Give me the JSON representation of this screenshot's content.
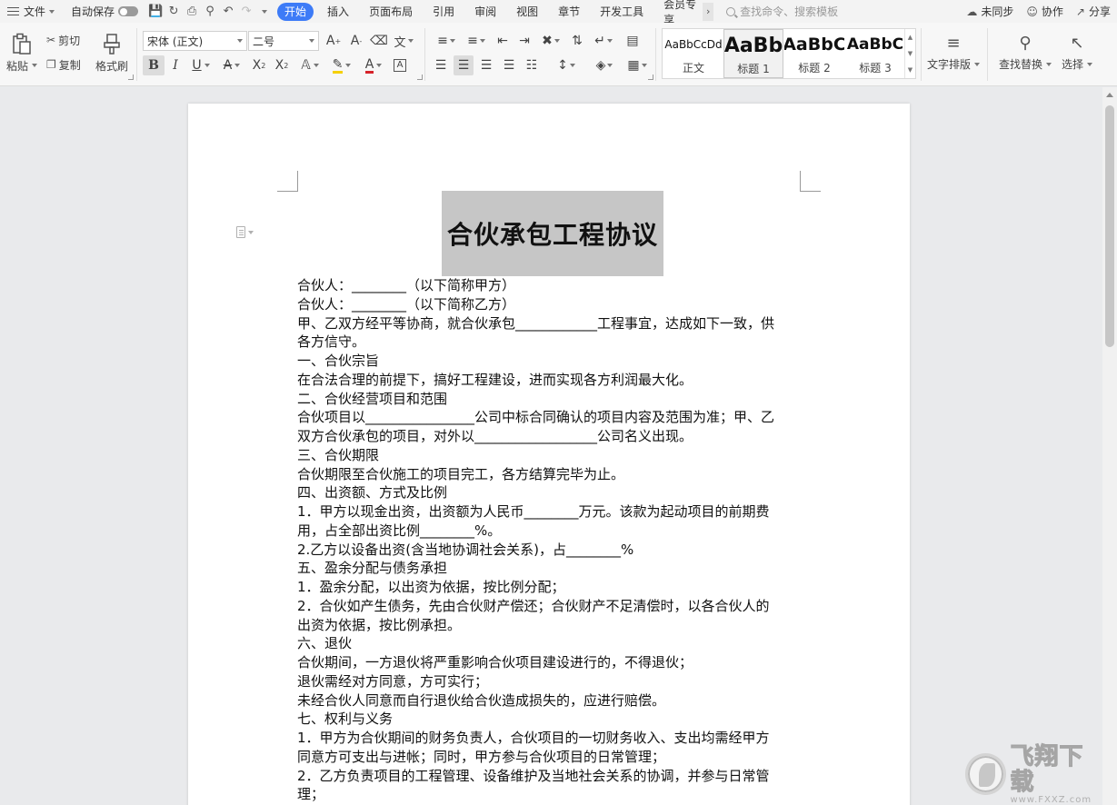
{
  "menubar": {
    "file_label": "文件",
    "autosave_label": "自动保存",
    "tabs": [
      "开始",
      "插入",
      "页面布局",
      "引用",
      "审阅",
      "视图",
      "章节",
      "开发工具",
      "会员专享"
    ],
    "active_tab_index": 0,
    "search_placeholder": "查找命令、搜索模板",
    "sync_label": "未同步",
    "collab_label": "协作",
    "share_label": "分享"
  },
  "ribbon": {
    "paste_label": "粘贴",
    "cut_label": "剪切",
    "copy_label": "复制",
    "format_painter_label": "格式刷",
    "font_name": "宋体 (正文)",
    "font_size": "二号",
    "styles": [
      {
        "sample": "AaBbCcDd",
        "name": "正文"
      },
      {
        "sample": "AaBb",
        "name": "标题 1"
      },
      {
        "sample": "AaBbC",
        "name": "标题 2"
      },
      {
        "sample": "AaBbC",
        "name": "标题 3"
      }
    ],
    "selected_style_index": 1,
    "text_layout_label": "文字排版",
    "find_replace_label": "查找替换",
    "select_label": "选择"
  },
  "document": {
    "title": "合伙承包工程协议",
    "paragraphs": [
      "合伙人：________（以下简称甲方）",
      "合伙人：________（以下简称乙方）",
      "甲、乙双方经平等协商，就合伙承包____________工程事宜，达成如下一致，供",
      "各方信守。",
      "一、合伙宗旨",
      "在合法合理的前提下，搞好工程建设，进而实现各方利润最大化。",
      "二、合伙经营项目和范围",
      "合伙项目以________________公司中标合同确认的项目内容及范围为准；甲、乙",
      "双方合伙承包的项目，对外以__________________公司名义出现。",
      "三、合伙期限",
      "合伙期限至合伙施工的项目完工，各方结算完毕为止。",
      "四、出资额、方式及比例",
      "1．甲方以现金出资，出资额为人民币________万元。该款为起动项目的前期费",
      "用，占全部出资比例________%。",
      "2.乙方以设备出资(含当地协调社会关系)，占________%",
      "五、盈余分配与债务承担",
      "1．盈余分配，以出资为依据，按比例分配；",
      "2．合伙如产生债务，先由合伙财产偿还；合伙财产不足清偿时，以各合伙人的",
      "出资为依据，按比例承担。",
      "六、退伙",
      "合伙期间，一方退伙将严重影响合伙项目建设进行的，不得退伙；",
      "退伙需经对方同意，方可实行；",
      "未经合伙人同意而自行退伙给合伙造成损失的，应进行赔偿。",
      "七、权利与义务",
      "1．甲方为合伙期间的财务负责人，合伙项目的一切财务收入、支出均需经甲方",
      "同意方可支出与进帐；同时，甲方参与合伙项目的日常管理；",
      "2．乙方负责项目的工程管理、设备维护及当地社会关系的协调，并参与日常管",
      "理；"
    ]
  },
  "watermark": {
    "name_cn": "飞翔下载",
    "name_en": "www.FXXZ.com"
  },
  "colors": {
    "accent": "#3d7bf7",
    "title_highlight": "#c6c6c6",
    "font_color_underline": "#d6232a",
    "highlight_underline": "#f5d000"
  }
}
